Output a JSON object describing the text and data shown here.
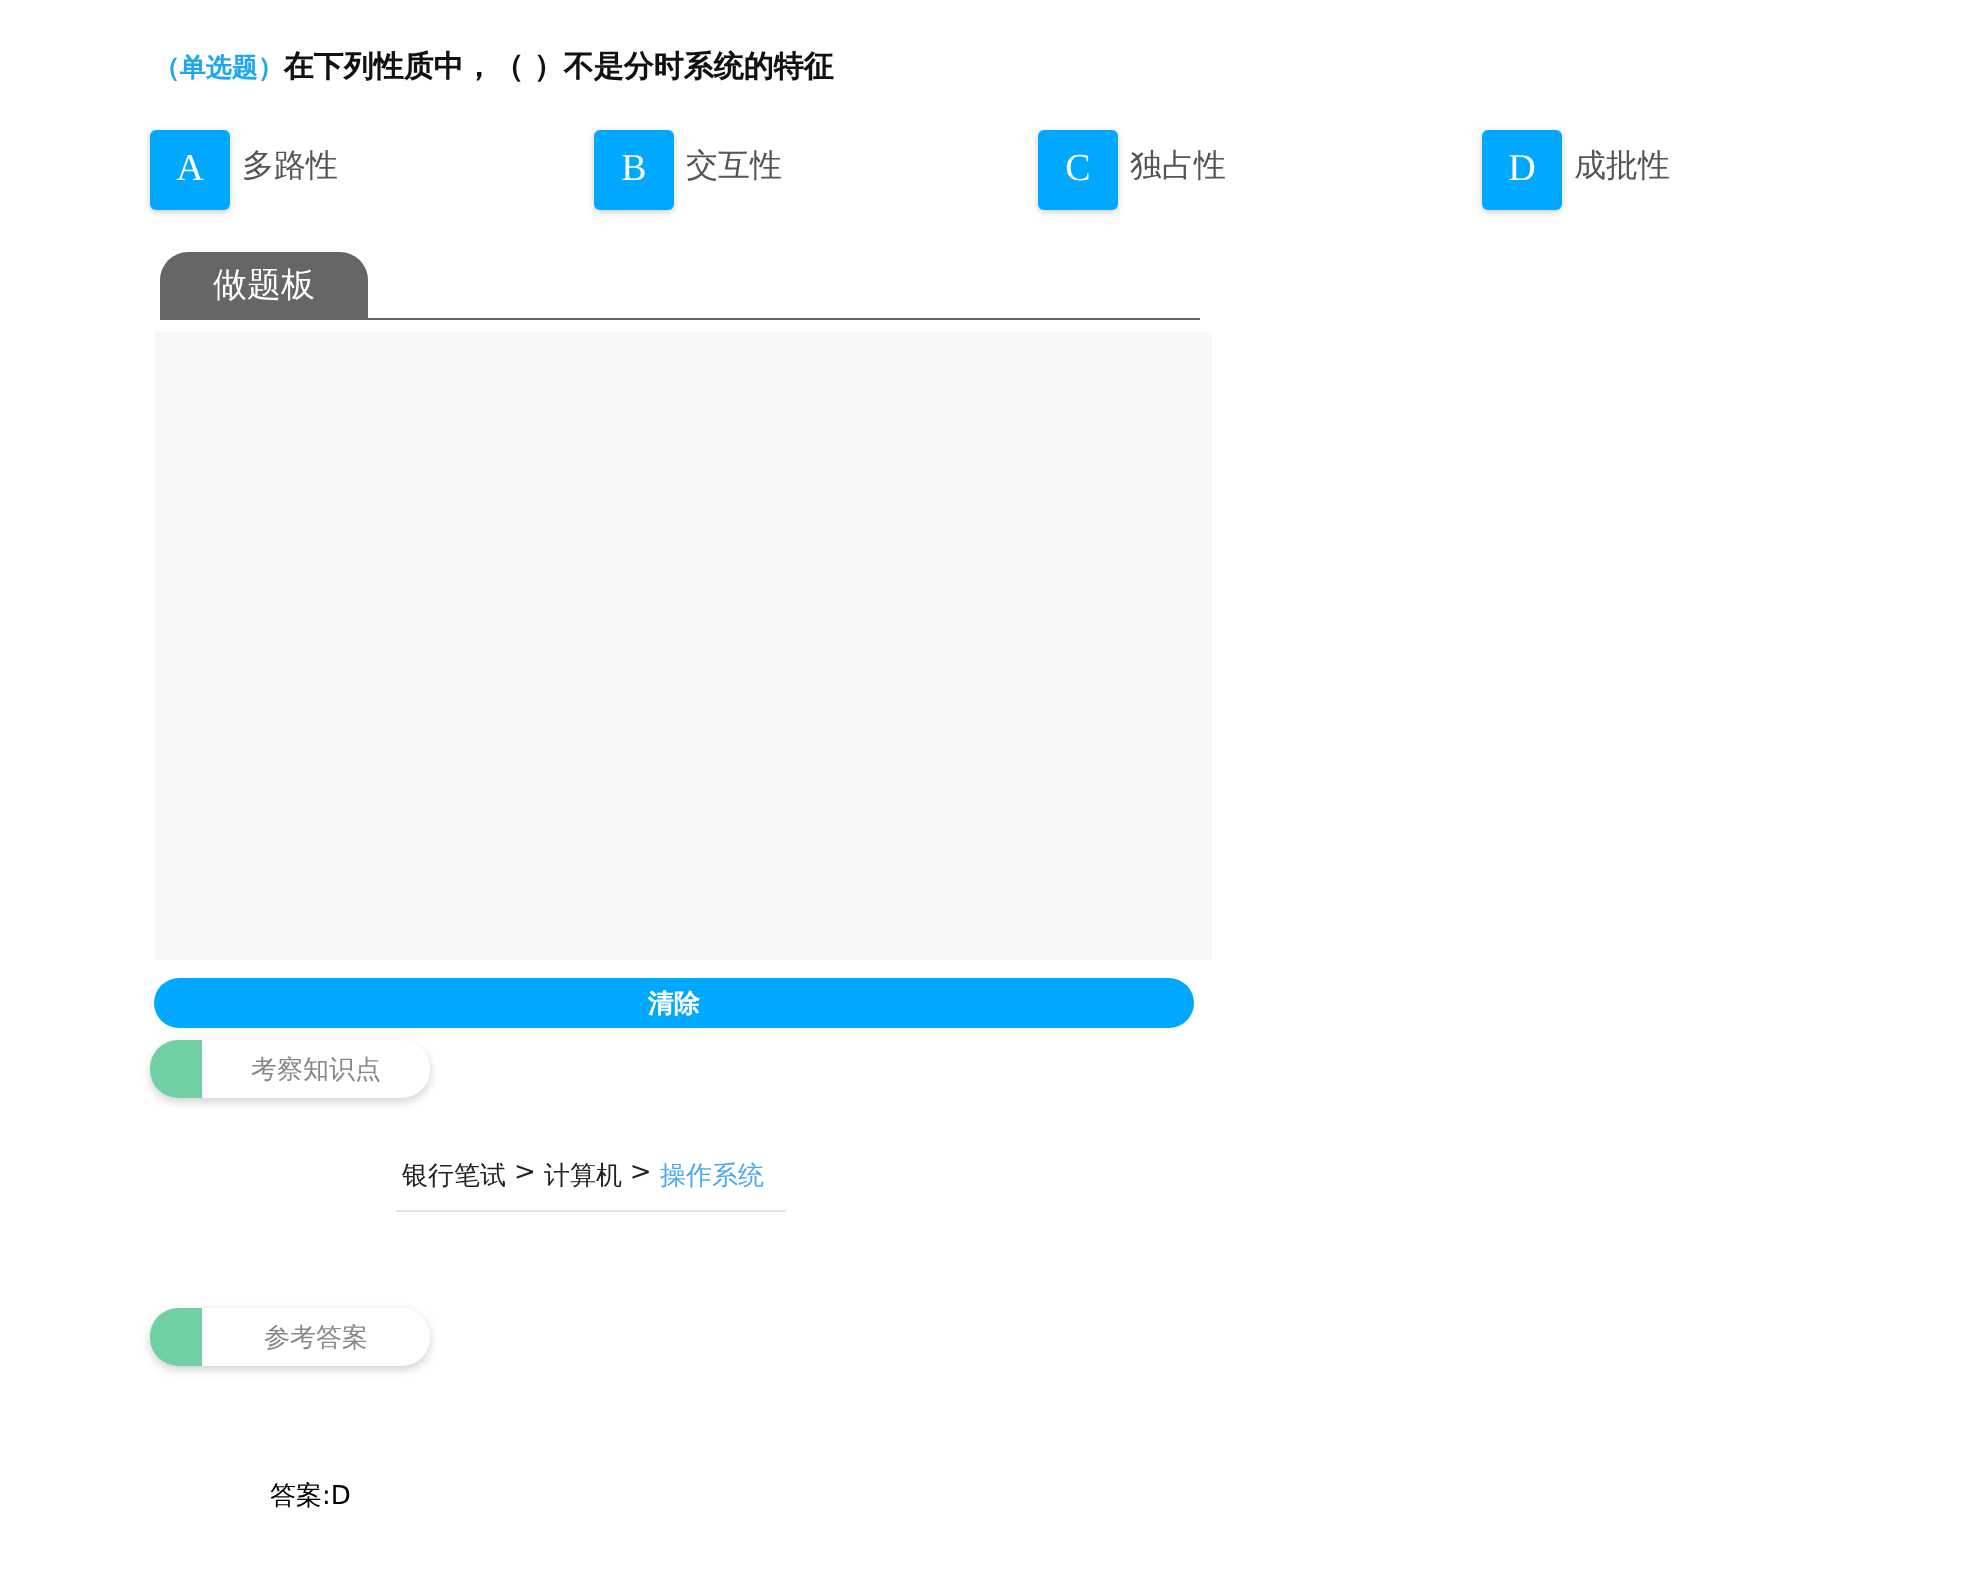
{
  "question": {
    "type_tag": "（单选题）",
    "text": "在下列性质中，（ ）不是分时系统的特征"
  },
  "options": [
    {
      "letter": "A",
      "text": "多路性"
    },
    {
      "letter": "B",
      "text": "交互性"
    },
    {
      "letter": "C",
      "text": "独占性"
    },
    {
      "letter": "D",
      "text": "成批性"
    }
  ],
  "board": {
    "tab": "做题板",
    "clear_button": "清除"
  },
  "knowledge": {
    "heading": "考察知识点",
    "breadcrumb": [
      {
        "label": "银行笔试",
        "selected": false
      },
      {
        "label": "计算机",
        "selected": false
      },
      {
        "label": "操作系统",
        "selected": true
      }
    ],
    "separators": [
      ">",
      ">"
    ]
  },
  "answer": {
    "heading": "参考答案",
    "text": "答案:D"
  }
}
